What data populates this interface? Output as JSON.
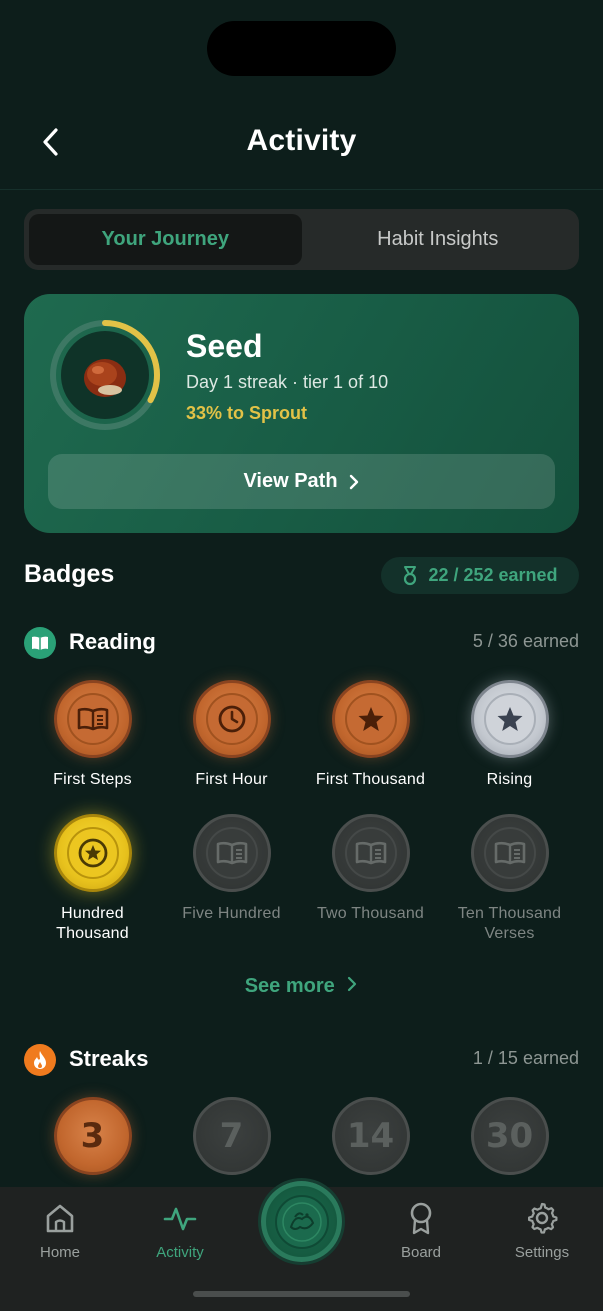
{
  "header": {
    "title": "Activity",
    "back_icon": "chevron-left-icon"
  },
  "segments": [
    {
      "label": "Your Journey",
      "active": true
    },
    {
      "label": "Habit Insights",
      "active": false
    }
  ],
  "journey": {
    "tier_name": "Seed",
    "subtitle": "Day 1 streak · tier 1 of 10",
    "progress_text": "33% to Sprout",
    "progress_fraction": 0.33,
    "icon": "chestnut-seed-icon",
    "view_path_label": "View Path"
  },
  "badges": {
    "title": "Badges",
    "earned_summary": "22 / 252 earned",
    "sections": {
      "reading": {
        "title": "Reading",
        "count": "5 / 36 earned",
        "items": [
          {
            "label": "First Steps",
            "tier": "bronze",
            "icon": "book-icon"
          },
          {
            "label": "First Hour",
            "tier": "bronze",
            "icon": "clock-icon"
          },
          {
            "label": "First Thousand",
            "tier": "bronze",
            "icon": "star-icon"
          },
          {
            "label": "Rising",
            "tier": "silver",
            "icon": "star-icon"
          },
          {
            "label": "Hundred Thousand",
            "tier": "gold",
            "icon": "star-circle-icon"
          },
          {
            "label": "Five Hundred",
            "tier": "locked",
            "icon": "book-icon"
          },
          {
            "label": "Two Thousand",
            "tier": "locked",
            "icon": "book-icon"
          },
          {
            "label": "Ten Thousand Verses",
            "tier": "locked",
            "icon": "book-icon"
          }
        ],
        "see_more": "See more"
      },
      "streaks": {
        "title": "Streaks",
        "count": "1 / 15 earned",
        "items": [
          {
            "value": "3",
            "tier": "bronze"
          },
          {
            "value": "7",
            "tier": "locked"
          },
          {
            "value": "14",
            "tier": "locked"
          },
          {
            "value": "30",
            "tier": "locked"
          }
        ]
      }
    }
  },
  "tabbar": {
    "items": [
      {
        "label": "Home",
        "icon": "home-icon"
      },
      {
        "label": "Activity",
        "icon": "activity-pulse-icon",
        "active": true
      },
      {
        "label": "",
        "icon": "quran-emblem-icon"
      },
      {
        "label": "Board",
        "icon": "award-ribbon-icon"
      },
      {
        "label": "Settings",
        "icon": "gear-icon"
      }
    ]
  },
  "colors": {
    "accent_green": "#3fa57d",
    "progress_gold": "#e2c247",
    "background": "#0d1e1b"
  }
}
